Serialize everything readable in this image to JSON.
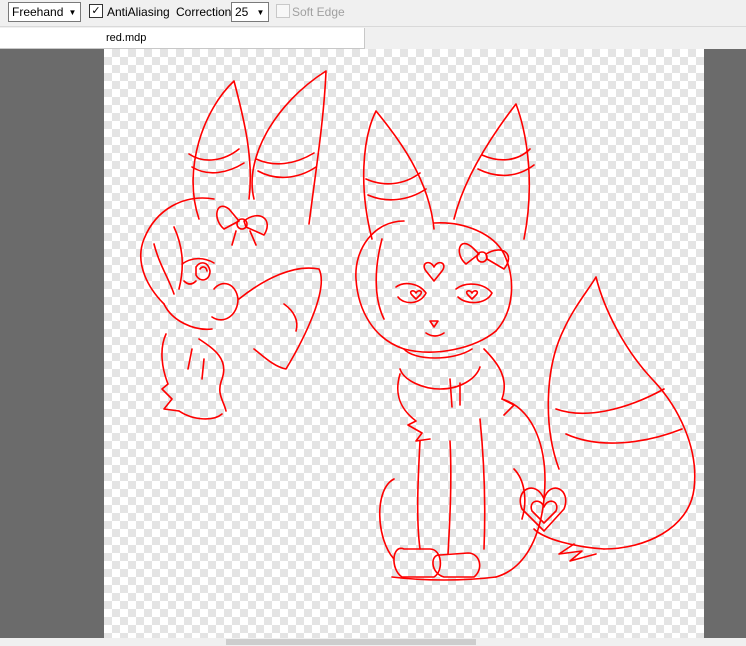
{
  "toolbar": {
    "brush_mode": "Freehand",
    "antialiasing_label": "AntiAliasing",
    "antialiasing_checked": true,
    "correction_label": "Correction",
    "correction_value": "25",
    "soft_edge_label": "Soft Edge",
    "soft_edge_checked": false
  },
  "document": {
    "tab_name": "red.mdp"
  },
  "colors": {
    "line_art": "#ff0000",
    "workspace": "#6b6b6b"
  }
}
